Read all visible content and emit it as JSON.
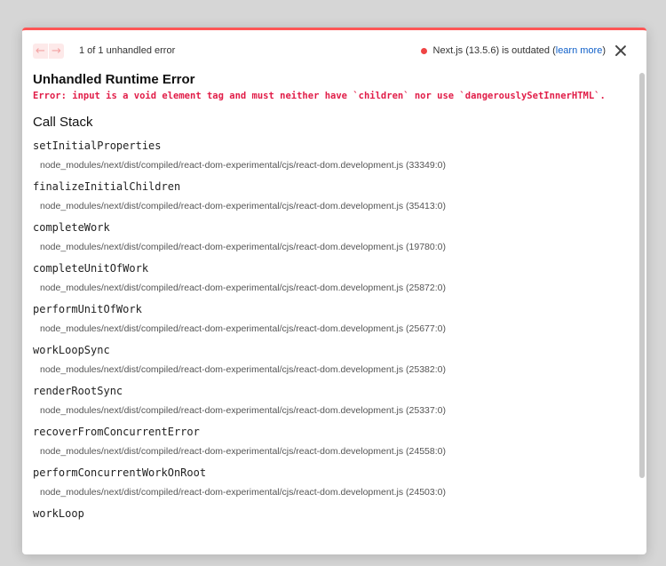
{
  "header": {
    "prev_icon": "←",
    "next_icon": "→",
    "count": "1 of 1 unhandled error",
    "version_text": "Next.js (13.5.6) is outdated",
    "learn_more_open": "(",
    "learn_more": "learn more",
    "learn_more_close": ")"
  },
  "title": "Unhandled Runtime Error",
  "error_message": "Error: input is a void element tag and must neither have `children` nor use `dangerouslySetInnerHTML`.",
  "call_stack_heading": "Call Stack",
  "frames": [
    {
      "name": "setInitialProperties",
      "path": "node_modules/next/dist/compiled/react-dom-experimental/cjs/react-dom.development.js (33349:0)"
    },
    {
      "name": "finalizeInitialChildren",
      "path": "node_modules/next/dist/compiled/react-dom-experimental/cjs/react-dom.development.js (35413:0)"
    },
    {
      "name": "completeWork",
      "path": "node_modules/next/dist/compiled/react-dom-experimental/cjs/react-dom.development.js (19780:0)"
    },
    {
      "name": "completeUnitOfWork",
      "path": "node_modules/next/dist/compiled/react-dom-experimental/cjs/react-dom.development.js (25872:0)"
    },
    {
      "name": "performUnitOfWork",
      "path": "node_modules/next/dist/compiled/react-dom-experimental/cjs/react-dom.development.js (25677:0)"
    },
    {
      "name": "workLoopSync",
      "path": "node_modules/next/dist/compiled/react-dom-experimental/cjs/react-dom.development.js (25382:0)"
    },
    {
      "name": "renderRootSync",
      "path": "node_modules/next/dist/compiled/react-dom-experimental/cjs/react-dom.development.js (25337:0)"
    },
    {
      "name": "recoverFromConcurrentError",
      "path": "node_modules/next/dist/compiled/react-dom-experimental/cjs/react-dom.development.js (24558:0)"
    },
    {
      "name": "performConcurrentWorkOnRoot",
      "path": "node_modules/next/dist/compiled/react-dom-experimental/cjs/react-dom.development.js (24503:0)"
    },
    {
      "name": "workLoop",
      "path": ""
    }
  ],
  "colors": {
    "accent": "#ff5555",
    "error_text": "#e11d48",
    "status_dot": "#ef4444",
    "link": "#1060c9"
  }
}
